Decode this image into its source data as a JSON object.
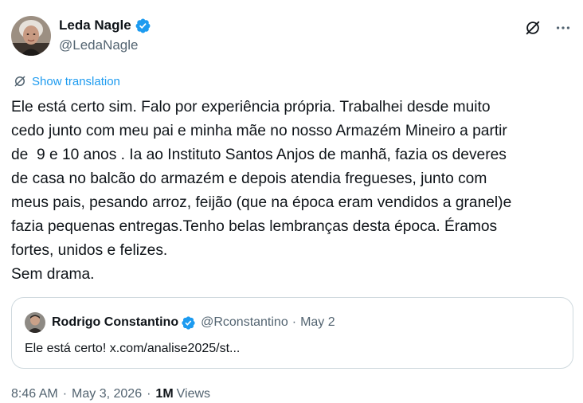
{
  "author": {
    "display_name": "Leda Nagle",
    "handle": "@LedaNagle"
  },
  "translation": {
    "label": "Show translation"
  },
  "tweet": {
    "text": "Ele está certo sim. Falo por experiência própria. Trabalhei desde muito\ncedo junto com meu pai e minha mãe no nosso Armazém Mineiro a partir\nde  9 e 10 anos . Ia ao Instituto Santos Anjos de manhã, fazia os deveres\nde casa no balcão do armazém e depois atendia fregueses, junto com\nmeus pais, pesando arroz, feijão (que na época eram vendidos a granel)e\nfazia pequenas entregas.Tenho belas lembranças desta época. Éramos\nfortes, unidos e felizes.\nSem drama."
  },
  "quoted_tweet": {
    "display_name": "Rodrigo Constantino",
    "handle": "@Rconstantino",
    "separator": "·",
    "date": "May 2",
    "text": "Ele está certo! x.com/analise2025/st..."
  },
  "meta": {
    "time": "8:46 AM",
    "separator": "·",
    "date": "May 3, 2026",
    "views_count": "1M",
    "views_label": "Views"
  },
  "colors": {
    "accent": "#1d9bf0",
    "text_primary": "#0f1419",
    "text_secondary": "#536471",
    "border": "#cfd9de"
  },
  "icons": {
    "verified": "verified-badge-icon",
    "grok": "grok-icon",
    "more": "more-icon",
    "translate": "translate-icon"
  }
}
